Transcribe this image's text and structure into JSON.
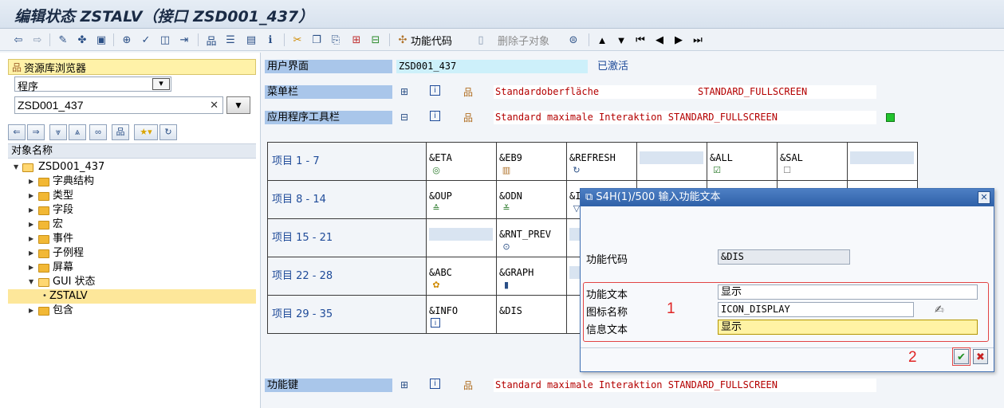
{
  "window": {
    "title": "编辑状态 ZSTALV（接口 ZSD001_437）"
  },
  "toolbar": {
    "func_code_label": "功能代码",
    "delete_sub_label": "删除子对象"
  },
  "left": {
    "repo_browser": "资源库浏览器",
    "type_select": "程序",
    "object_name": "ZSD001_437",
    "tree_header": "对象名称",
    "tree": [
      {
        "label": "ZSD001_437",
        "level": 0,
        "expanded": true
      },
      {
        "label": "字典结构",
        "level": 1
      },
      {
        "label": "类型",
        "level": 1
      },
      {
        "label": "字段",
        "level": 1
      },
      {
        "label": "宏",
        "level": 1
      },
      {
        "label": "事件",
        "level": 1
      },
      {
        "label": "子例程",
        "level": 1
      },
      {
        "label": "屏幕",
        "level": 1
      },
      {
        "label": "GUI 状态",
        "level": 1,
        "expanded": true
      },
      {
        "label": "ZSTALV",
        "level": 2,
        "selected": true
      },
      {
        "label": "包含",
        "level": 1
      }
    ]
  },
  "main": {
    "ui_label": "用户界面",
    "ui_value": "ZSD001_437",
    "ui_status": "已激活",
    "menubar_label": "菜单栏",
    "menubar_text": "Standardoberfläche",
    "menubar_name": "STANDARD_FULLSCREEN",
    "apptb_label": "应用程序工具栏",
    "apptb_text": "Standard maximale Interaktion STANDARD_FULLSCREEN",
    "funckey_label": "功能键",
    "funckey_text": "Standard maximale Interaktion STANDARD_FULLSCREEN",
    "grid": {
      "rows": [
        {
          "header": "项目  1 -  7",
          "cells": [
            "&ETA",
            "&EB9",
            "&REFRESH",
            "",
            "&ALL",
            "&SAL",
            ""
          ]
        },
        {
          "header": "项目  8 - 14",
          "cells": [
            "&OUP",
            "&ODN",
            "&I",
            "",
            "",
            "",
            ""
          ]
        },
        {
          "header": "项目 15 - 21",
          "cells": [
            "",
            "&RNT_PREV",
            "",
            "",
            "",
            "",
            ""
          ]
        },
        {
          "header": "项目 22 - 28",
          "cells": [
            "&ABC",
            "&GRAPH",
            "",
            "",
            "",
            "",
            ""
          ]
        },
        {
          "header": "项目 29 - 35",
          "cells": [
            "&INFO",
            "&DIS",
            "",
            "",
            "",
            "",
            ""
          ]
        }
      ]
    }
  },
  "dialog": {
    "title": "S4H(1)/500 输入功能文本",
    "func_code_label": "功能代码",
    "func_code_value": "&DIS",
    "func_text_label": "功能文本",
    "func_text_value": "显示",
    "icon_name_label": "图标名称",
    "icon_name_value": "ICON_DISPLAY",
    "info_text_label": "信息文本",
    "info_text_value": "显示",
    "annot_1": "1",
    "annot_2": "2"
  },
  "colors": {
    "label_bg": "#a9c6ea",
    "accent_red": "#e24444",
    "active_green": "#22c32e"
  }
}
